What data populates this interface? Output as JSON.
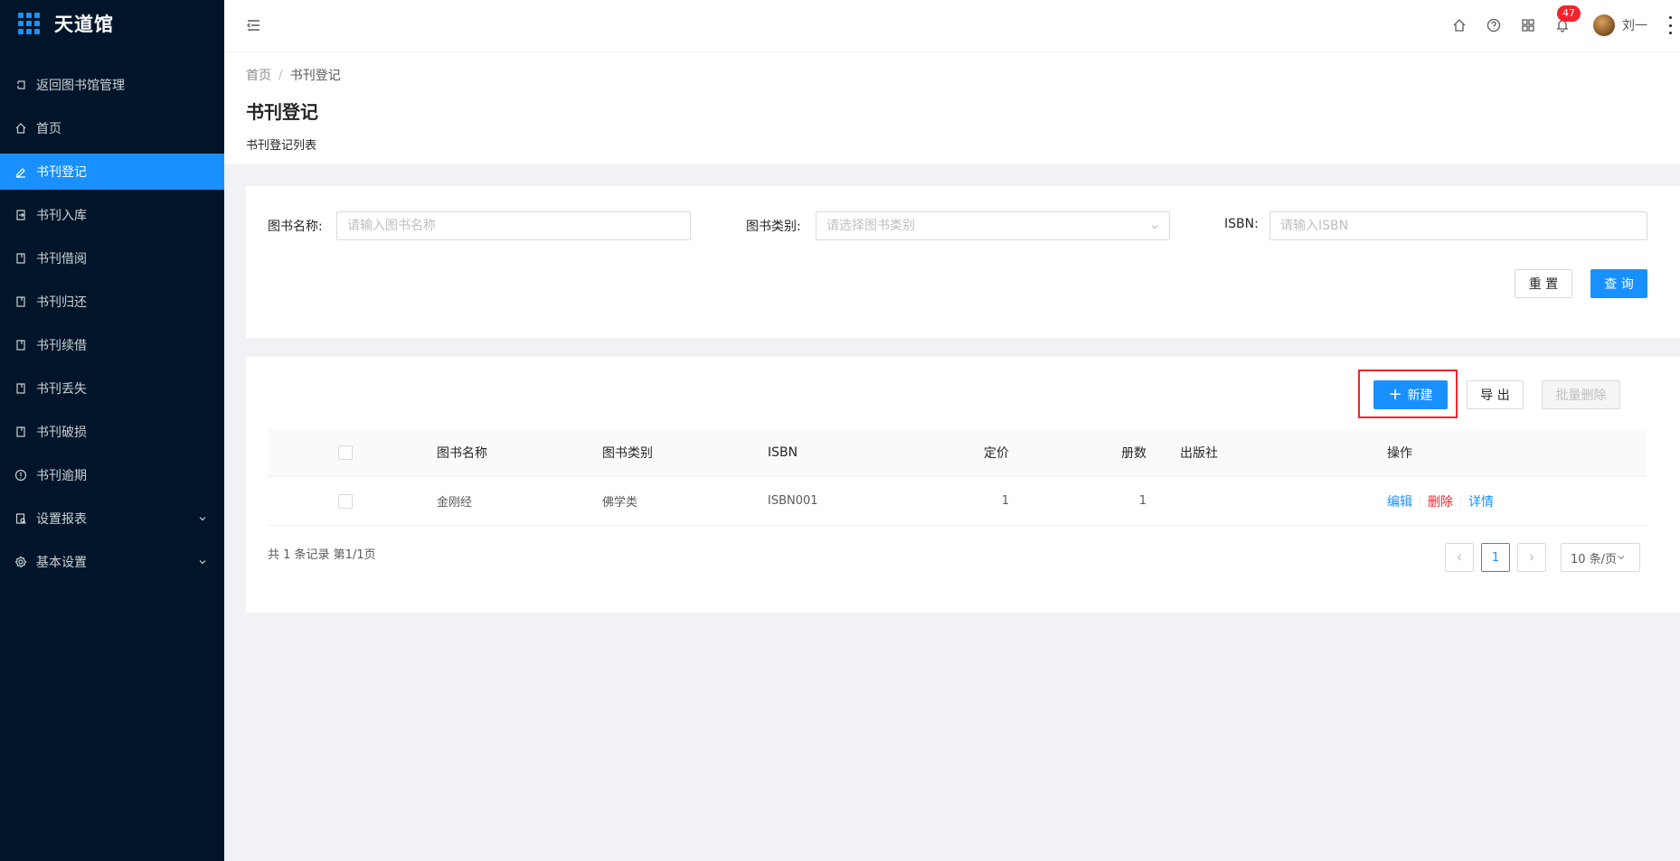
{
  "app": {
    "title": "天道馆"
  },
  "sidebar": {
    "items": [
      {
        "label": "返回图书馆管理",
        "icon": "return-icon",
        "active": false
      },
      {
        "label": "首页",
        "icon": "home-icon",
        "active": false
      },
      {
        "label": "书刊登记",
        "icon": "edit-icon",
        "active": true
      },
      {
        "label": "书刊入库",
        "icon": "import-icon",
        "active": false
      },
      {
        "label": "书刊借阅",
        "icon": "book-icon",
        "active": false
      },
      {
        "label": "书刊归还",
        "icon": "book-icon",
        "active": false
      },
      {
        "label": "书刊续借",
        "icon": "book-icon",
        "active": false
      },
      {
        "label": "书刊丢失",
        "icon": "book-icon",
        "active": false
      },
      {
        "label": "书刊破损",
        "icon": "book-icon",
        "active": false
      },
      {
        "label": "书刊逾期",
        "icon": "info-icon",
        "active": false
      },
      {
        "label": "设置报表",
        "icon": "report-icon",
        "active": false,
        "expandable": true
      },
      {
        "label": "基本设置",
        "icon": "settings-icon",
        "active": false,
        "expandable": true
      }
    ]
  },
  "header": {
    "notification_count": "47",
    "user_name": "刘一"
  },
  "breadcrumb": {
    "home": "首页",
    "separator": "/",
    "current": "书刊登记"
  },
  "page": {
    "title": "书刊登记",
    "subtitle": "书刊登记列表"
  },
  "search": {
    "name_label": "图书名称:",
    "name_placeholder": "请输入图书名称",
    "category_label": "图书类别:",
    "category_placeholder": "请选择图书类别",
    "isbn_label": "ISBN:",
    "isbn_placeholder": "请输入ISBN",
    "reset_label": "重 置",
    "query_label": "查 询"
  },
  "toolbar": {
    "new_label": "新建",
    "export_label": "导 出",
    "batch_delete_label": "批量删除"
  },
  "table": {
    "columns": [
      "图书名称",
      "图书类别",
      "ISBN",
      "定价",
      "册数",
      "出版社",
      "操作"
    ],
    "rows": [
      {
        "name": "金刚经",
        "category": "佛学类",
        "isbn": "ISBN001",
        "price": "1",
        "count": "1",
        "publisher": "",
        "actions": {
          "edit": "编辑",
          "delete": "删除",
          "detail": "详情"
        }
      }
    ]
  },
  "pagination": {
    "total_text": "共 1 条记录 第1/1页",
    "current_page": "1",
    "page_size": "10 条/页"
  },
  "colors": {
    "primary": "#1890ff",
    "sidebar_bg": "#001529",
    "danger": "#f5222d"
  }
}
